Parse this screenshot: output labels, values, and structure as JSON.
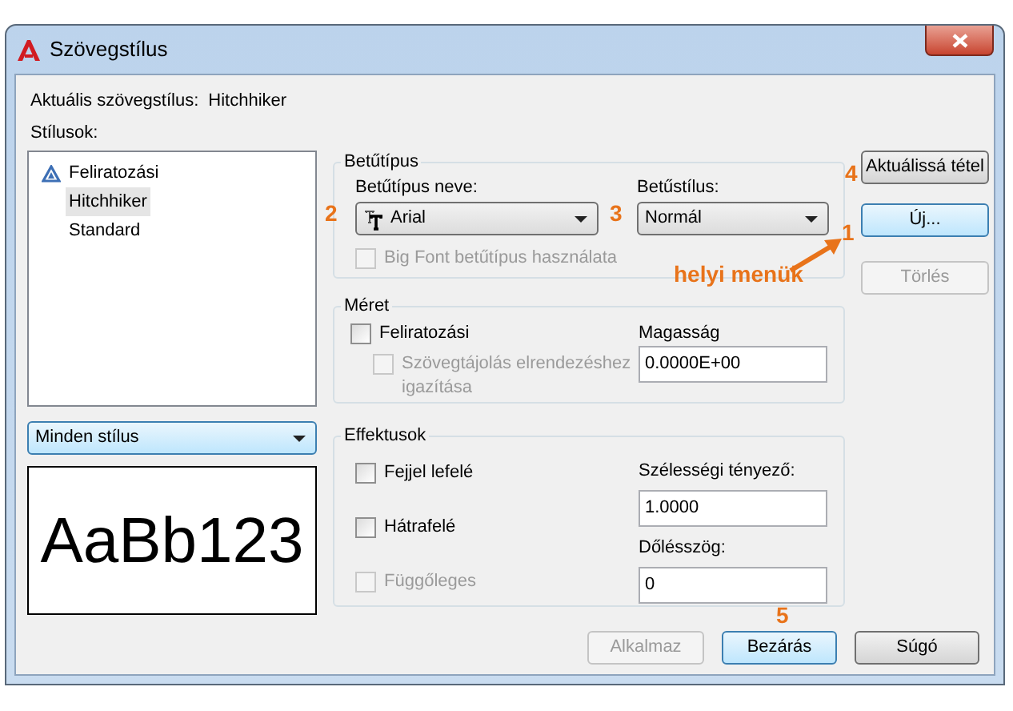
{
  "window": {
    "title": "Szövegstílus"
  },
  "current_style": {
    "label": "Aktuális szövegstílus:",
    "value": "Hitchhiker"
  },
  "styles": {
    "label": "Stílusok:",
    "items": [
      {
        "name": "Feliratozási",
        "annotative": true,
        "selected": false
      },
      {
        "name": "Hitchhiker",
        "annotative": false,
        "selected": true
      },
      {
        "name": "Standard",
        "annotative": false,
        "selected": false
      }
    ]
  },
  "style_filter": {
    "value": "Minden stílus"
  },
  "preview": {
    "text": "AaBb123"
  },
  "font": {
    "title": "Betűtípus",
    "name_label": "Betűtípus neve:",
    "name_value": "Arial",
    "style_label": "Betűstílus:",
    "style_value": "Normál",
    "big_font": {
      "label": "Big Font betűtípus használata",
      "checked": false,
      "disabled": true
    }
  },
  "size": {
    "title": "Méret",
    "annotative": {
      "label": "Feliratozási",
      "checked": false,
      "disabled": false
    },
    "match_orientation": {
      "label": "Szövegtájolás elrendezéshez igazítása",
      "checked": false,
      "disabled": true
    },
    "height_label": "Magasság",
    "height_value": "0.0000E+00"
  },
  "effects": {
    "title": "Effektusok",
    "checkboxes": [
      {
        "label": "Fejjel lefelé",
        "checked": false,
        "disabled": false
      },
      {
        "label": "Hátrafelé",
        "checked": false,
        "disabled": false
      },
      {
        "label": "Függőleges",
        "checked": false,
        "disabled": true
      }
    ],
    "width_label": "Szélességi tényező:",
    "width_value": "1.0000",
    "oblique_label": "Dőlésszög:",
    "oblique_value": "0"
  },
  "side_buttons": [
    {
      "label": "Aktuálissá tétel",
      "disabled": false,
      "focused": false
    },
    {
      "label": "Új...",
      "disabled": false,
      "focused": true
    },
    {
      "label": "Törlés",
      "disabled": true,
      "focused": false
    }
  ],
  "bottom_buttons": [
    {
      "label": "Alkalmaz",
      "disabled": true,
      "focused": false
    },
    {
      "label": "Bezárás",
      "disabled": false,
      "focused": true
    },
    {
      "label": "Súgó",
      "disabled": false,
      "focused": false
    }
  ],
  "callouts": [
    {
      "text": "2"
    },
    {
      "text": "3"
    },
    {
      "text": "4"
    },
    {
      "text": "1"
    },
    {
      "text": "helyi menük"
    },
    {
      "text": "5"
    }
  ]
}
